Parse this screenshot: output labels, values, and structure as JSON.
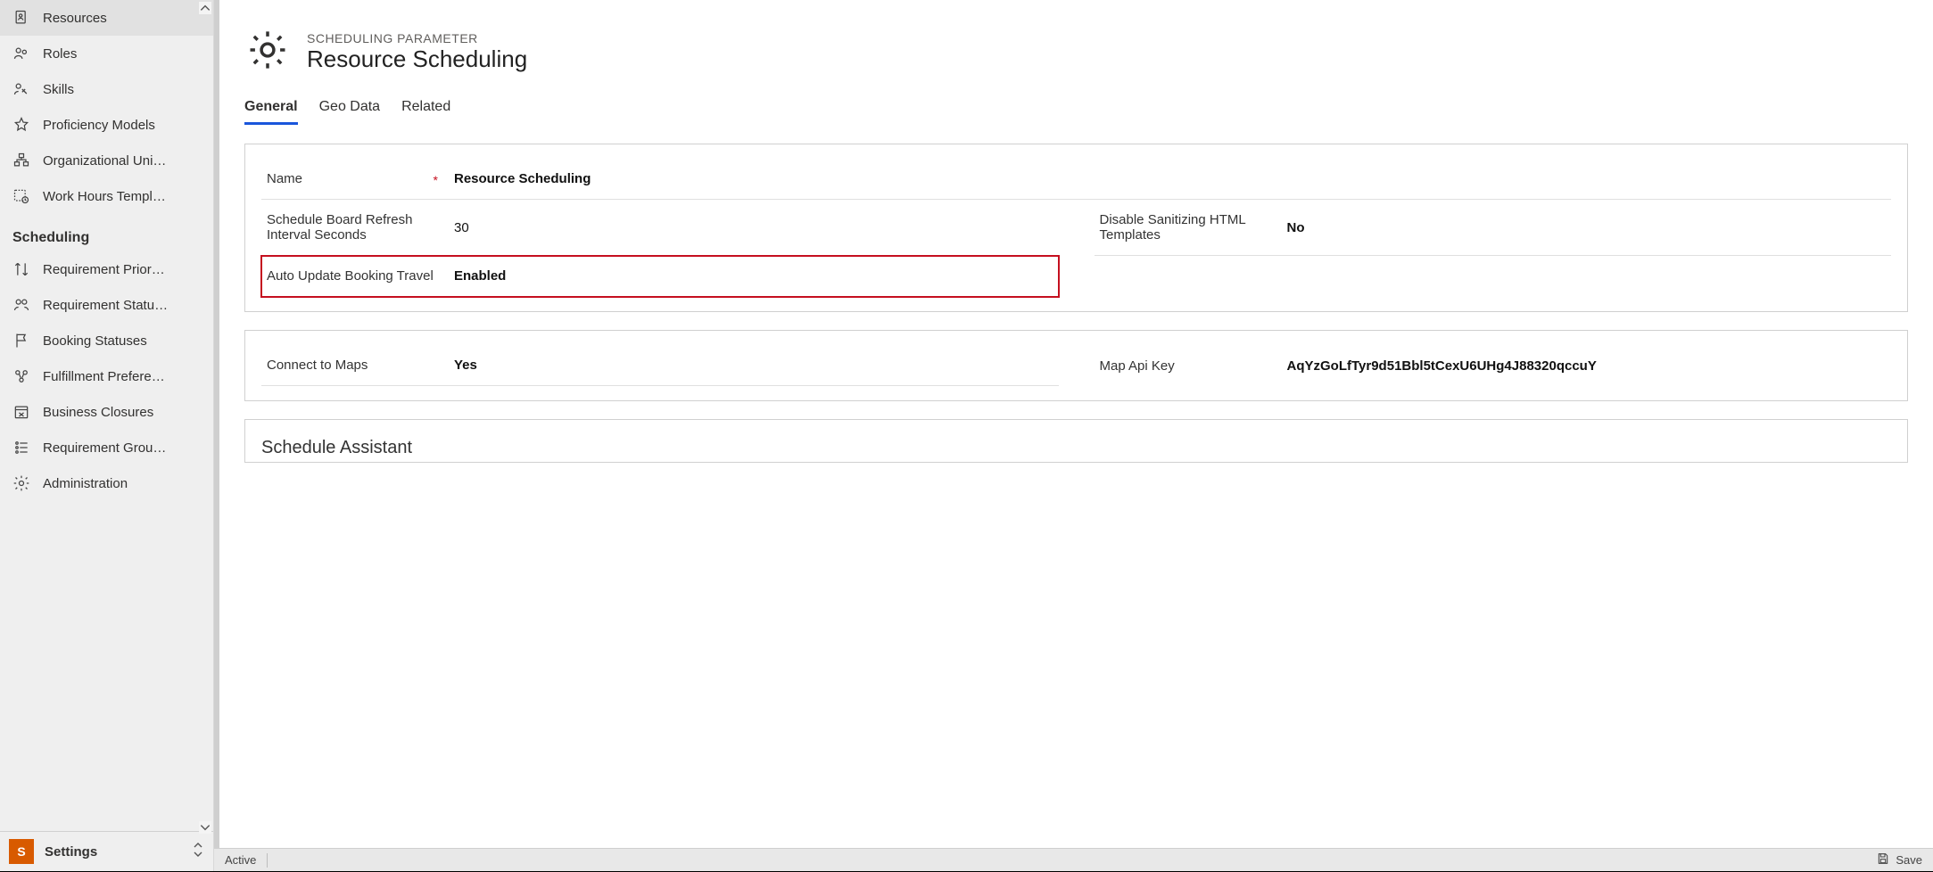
{
  "sidebar": {
    "items": [
      {
        "label": "Resources",
        "icon": "resources"
      },
      {
        "label": "Roles",
        "icon": "roles"
      },
      {
        "label": "Skills",
        "icon": "skills"
      },
      {
        "label": "Proficiency Models",
        "icon": "star"
      },
      {
        "label": "Organizational Uni…",
        "icon": "org"
      },
      {
        "label": "Work Hours Templ…",
        "icon": "workhours"
      }
    ],
    "group_header": "Scheduling",
    "items2": [
      {
        "label": "Requirement Prior…",
        "icon": "priority"
      },
      {
        "label": "Requirement Statu…",
        "icon": "reqstatus"
      },
      {
        "label": "Booking Statuses",
        "icon": "flag"
      },
      {
        "label": "Fulfillment Prefere…",
        "icon": "fulfill"
      },
      {
        "label": "Business Closures",
        "icon": "calendar-x"
      },
      {
        "label": "Requirement Grou…",
        "icon": "reqgroup"
      },
      {
        "label": "Administration",
        "icon": "gear"
      }
    ],
    "area": {
      "initial": "S",
      "label": "Settings"
    }
  },
  "header": {
    "eyebrow": "SCHEDULING PARAMETER",
    "title": "Resource Scheduling"
  },
  "tabs": {
    "general": "General",
    "geo": "Geo Data",
    "related": "Related"
  },
  "form": {
    "name_label": "Name",
    "name_value": "Resource Scheduling",
    "refresh_label": "Schedule Board Refresh Interval Seconds",
    "refresh_value": "30",
    "disable_sanitize_label": "Disable Sanitizing HTML Templates",
    "disable_sanitize_value": "No",
    "auto_update_label": "Auto Update Booking Travel",
    "auto_update_value": "Enabled",
    "connect_maps_label": "Connect to Maps",
    "connect_maps_value": "Yes",
    "map_api_label": "Map Api Key",
    "map_api_value": "AqYzGoLfTyr9d51Bbl5tCexU6UHg4J88320qccuY",
    "schedule_assistant_title": "Schedule Assistant"
  },
  "status": {
    "state": "Active",
    "save": "Save"
  }
}
